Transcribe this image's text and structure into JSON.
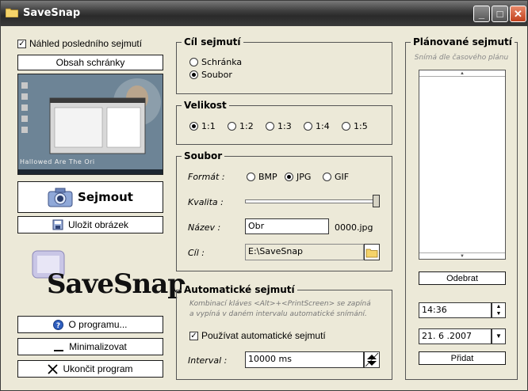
{
  "window": {
    "title": "SaveSnap"
  },
  "left": {
    "preview_checkbox_label": "Náhled posledního sejmutí",
    "clipboard_button": "Obsah schránky",
    "preview_caption": "Hallowed Are The Ori",
    "capture_button": "Sejmout",
    "save_button": "Uložit obrázek",
    "logo_text": "SaveSnap",
    "about_button": "O programu...",
    "minimize_button": "Minimalizovat",
    "quit_button": "Ukončit program"
  },
  "target": {
    "title": "Cíl sejmutí",
    "options": [
      "Schránka",
      "Soubor"
    ],
    "selected": "Soubor"
  },
  "size": {
    "title": "Velikost",
    "options": [
      "1:1",
      "1:2",
      "1:3",
      "1:4",
      "1:5"
    ],
    "selected": "1:1"
  },
  "file": {
    "title": "Soubor",
    "format_label": "Formát :",
    "formats": [
      "BMP",
      "JPG",
      "GIF"
    ],
    "selected_format": "JPG",
    "quality_label": "Kvalita :",
    "quality_fraction": 1.0,
    "name_label": "Název :",
    "name_value": "Obr",
    "name_suffix": "0000.jpg",
    "dest_label": "Cíl :",
    "dest_value": "E:\\SaveSnap"
  },
  "auto": {
    "title": "Automatické sejmutí",
    "hint_line1": "Kombinací kláves <Alt>+<PrintScreen> se zapíná",
    "hint_line2": "a vypíná v daném intervalu automatické snímání.",
    "checkbox_label": "Používat automatické sejmutí",
    "interval_label": "Interval :",
    "interval_value": "10000 ms"
  },
  "planned": {
    "title": "Plánované sejmutí",
    "subtitle": "Snímá dle časového plánu",
    "remove_button": "Odebrat",
    "time_value": "14:36",
    "date_value": "21. 6 .2007",
    "add_button": "Přidat"
  }
}
